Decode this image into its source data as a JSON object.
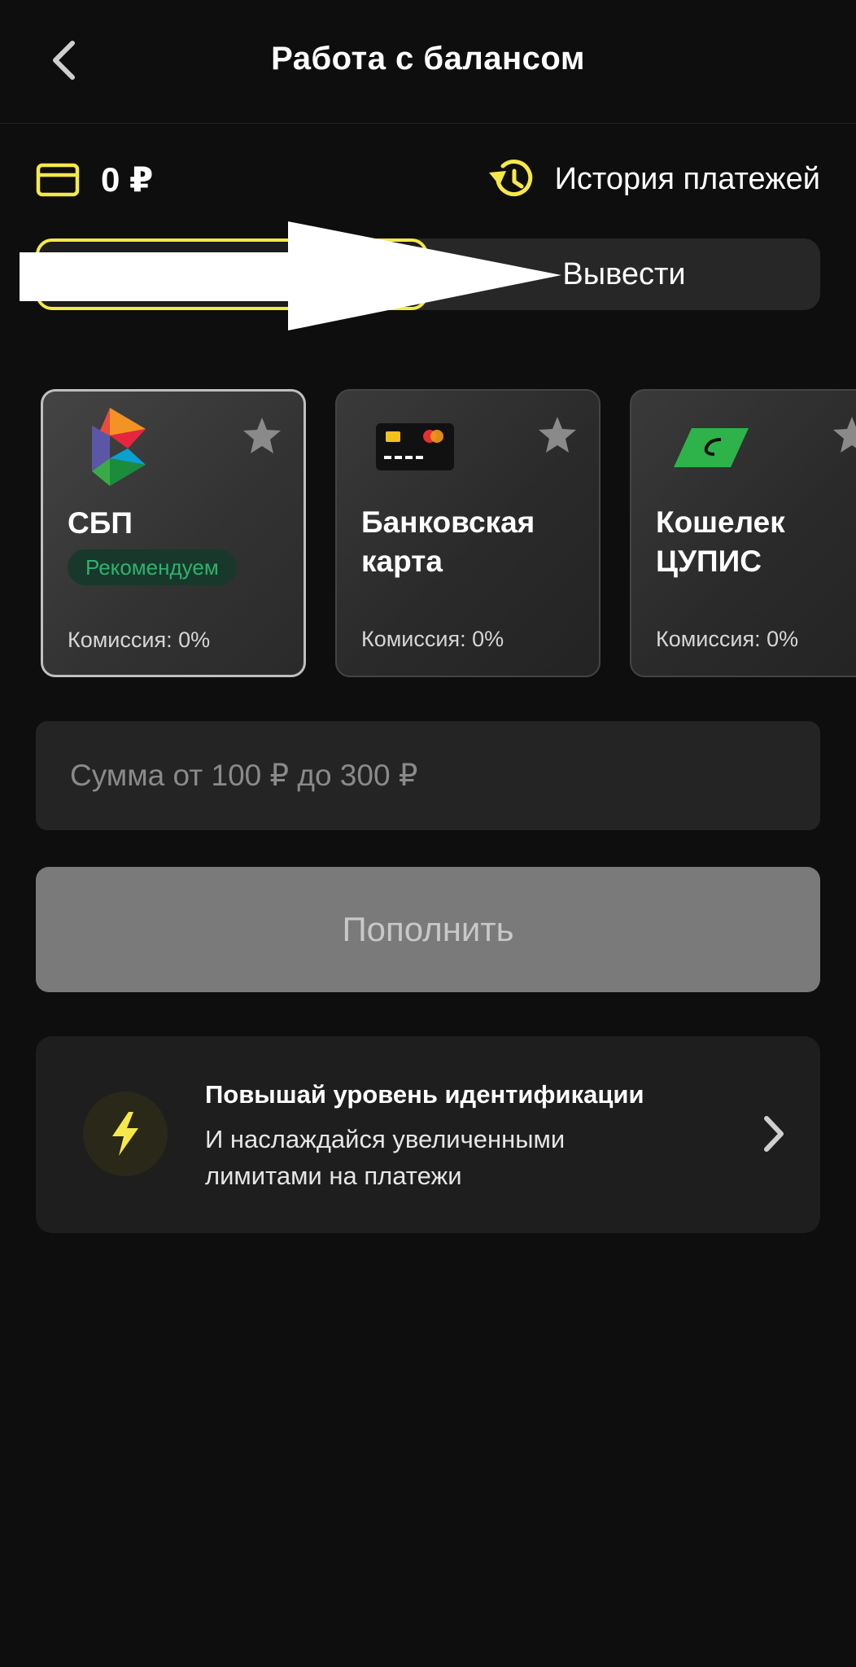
{
  "header": {
    "title": "Работа с балансом"
  },
  "balance": {
    "value": "0 ₽"
  },
  "history": {
    "label": "История платежей"
  },
  "tabs": {
    "deposit_label": "",
    "withdraw_label": "Вывести"
  },
  "methods": [
    {
      "name": "СБП",
      "badge": "Рекомендуем",
      "fee": "Комиссия: 0%"
    },
    {
      "name": "Банковская карта",
      "fee": "Комиссия: 0%"
    },
    {
      "name": "Кошелек ЦУПИС",
      "fee": "Комиссия: 0%"
    }
  ],
  "amount": {
    "placeholder": "Сумма от 100 ₽ до 300 ₽"
  },
  "submit": {
    "label": "Пополнить"
  },
  "promo": {
    "title": "Повышай уровень идентификации",
    "text": "И наслаждайся увеличенными лимитами на платежи"
  },
  "colors": {
    "accent": "#f5e84a",
    "background": "#0e0e0e",
    "recommend": "#2fb26e",
    "button_disabled": "#7a7a7a"
  },
  "icons": [
    "back-arrow-icon",
    "card-icon",
    "history-icon",
    "star-icon",
    "sbp-logo-icon",
    "bank-card-icon",
    "cupis-logo-icon",
    "lightning-icon",
    "chevron-right-icon"
  ]
}
